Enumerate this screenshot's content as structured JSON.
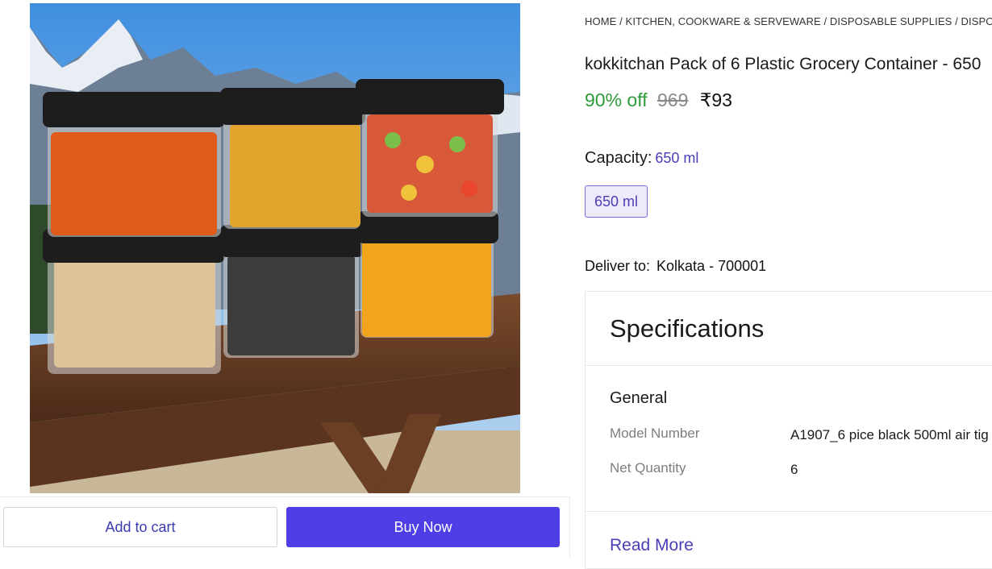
{
  "breadcrumb": {
    "items": [
      "HOME",
      "KITCHEN, COOKWARE & SERVEWARE",
      "DISPOSABLE SUPPLIES",
      "DISPOSABL"
    ],
    "separator": " / "
  },
  "product": {
    "title": "kokkitchan Pack of 6 Plastic Grocery Container  - 650",
    "discount": "90% off",
    "mrp": "969",
    "price": "₹93"
  },
  "capacity": {
    "label": "Capacity:",
    "selected": "650 ml",
    "options": [
      "650 ml"
    ]
  },
  "delivery": {
    "label": "Deliver to:",
    "location": "Kolkata - 700001"
  },
  "specifications": {
    "heading": "Specifications",
    "group": "General",
    "rows": [
      {
        "key": "Model Number",
        "value": "A1907_6 pice black 500ml air tig"
      },
      {
        "key": "Net Quantity",
        "value": "6"
      }
    ],
    "read_more": "Read More"
  },
  "actions": {
    "add_to_cart": "Add to cart",
    "buy_now": "Buy Now"
  },
  "colors": {
    "accent": "#4f3ee6",
    "discount_green": "#2f9a3a",
    "link_purple": "#4a3fb4"
  }
}
